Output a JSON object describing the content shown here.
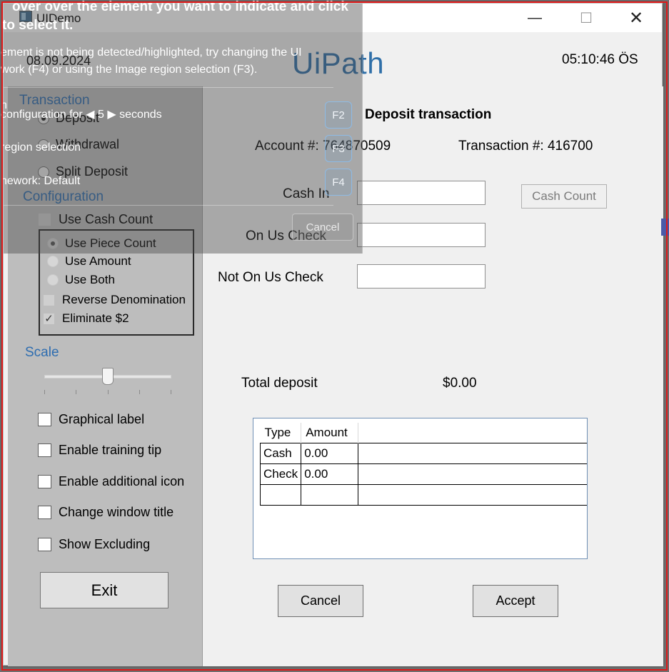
{
  "window": {
    "title": "UIDemo",
    "min_glyph": "—",
    "max_glyph": "☐",
    "close_glyph": "✕"
  },
  "header": {
    "date": "08.09.2024",
    "logo": "UiPath",
    "time": "05:10:46 ÖS"
  },
  "left": {
    "transaction_label": "Transaction",
    "transaction_options": [
      {
        "label": "Deposit",
        "checked": true
      },
      {
        "label": "Withdrawal",
        "checked": false
      },
      {
        "label": "Split Deposit",
        "checked": false
      }
    ],
    "configuration_label": "Configuration",
    "use_cash_count": "Use Cash Count",
    "count_options": [
      {
        "label": "Use Piece Count",
        "checked": true
      },
      {
        "label": "Use Amount",
        "checked": false
      },
      {
        "label": "Use Both",
        "checked": false
      }
    ],
    "reverse_denomination": "Reverse Denomination",
    "eliminate_2": "Eliminate $2",
    "scale_label": "Scale",
    "scale_value": 0.5,
    "options": [
      {
        "label": "Graphical label",
        "checked": false
      },
      {
        "label": "Enable training tip",
        "checked": false
      },
      {
        "label": "Enable additional icon",
        "checked": false
      },
      {
        "label": "Change window title",
        "checked": false
      },
      {
        "label": "Show Excluding",
        "checked": false
      }
    ],
    "exit_label": "Exit"
  },
  "form": {
    "title": "Deposit transaction",
    "account_label": "Account #: 764870509",
    "transaction_label": "Transaction #: 416700",
    "cash_in_label": "Cash In",
    "on_us_label": "On Us Check",
    "not_on_us_label": "Not On Us Check",
    "cash_in_value": "",
    "on_us_value": "",
    "not_on_us_value": "",
    "cash_count_label": "Cash Count",
    "total_label": "Total deposit",
    "total_value": "$0.00",
    "grid": {
      "headers": [
        "Type",
        "Amount"
      ],
      "rows": [
        [
          "Cash",
          "0.00"
        ],
        [
          "Check",
          "0.00"
        ],
        [
          "",
          ""
        ]
      ]
    },
    "cancel_label": "Cancel",
    "accept_label": "Accept"
  },
  "overlay": {
    "line1": "over over the element you want to indicate and click",
    "line2": "to select it.",
    "line3": "ement is not being detected/highlighted, try changing the UI",
    "line4": "work (F4) or using the Image region selection (F3).",
    "line5_prefix": "configuration for",
    "delay_value": "5",
    "line5_suffix": "seconds",
    "line6": "region selection",
    "line7": "nework: Default",
    "h_fragment": "h",
    "keys": [
      "F2",
      "F3",
      "F4"
    ],
    "cancel": "Cancel"
  }
}
